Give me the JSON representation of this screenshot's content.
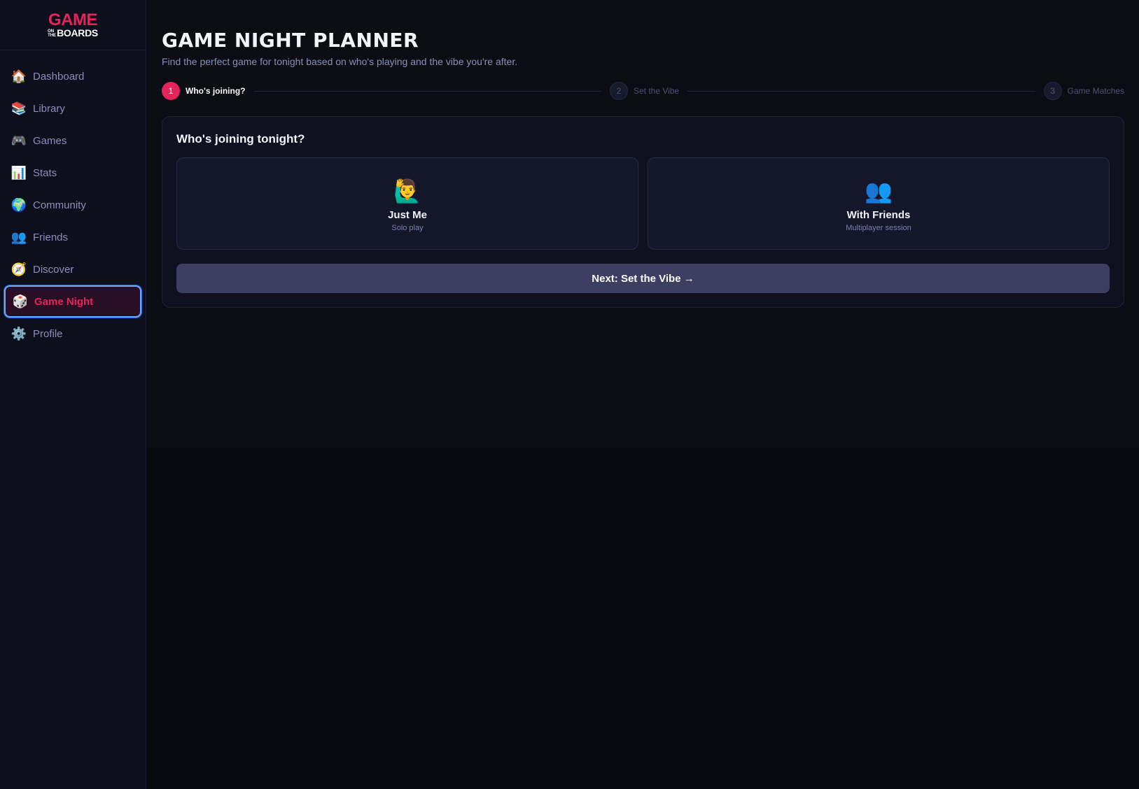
{
  "brand": {
    "logo_top": "GAME",
    "logo_small": "ON",
    "logo_small2": "THE",
    "logo_bottom": "BOARDS",
    "accent_color": "#e5245a"
  },
  "sidebar": {
    "items": [
      {
        "label": "Dashboard",
        "icon": "🏠",
        "icon_name": "house-icon"
      },
      {
        "label": "Library",
        "icon": "📚",
        "icon_name": "books-icon"
      },
      {
        "label": "Games",
        "icon": "🎮",
        "icon_name": "gamepad-icon"
      },
      {
        "label": "Stats",
        "icon": "📊",
        "icon_name": "bar-chart-icon"
      },
      {
        "label": "Community",
        "icon": "🌍",
        "icon_name": "globe-icon"
      },
      {
        "label": "Friends",
        "icon": "👥",
        "icon_name": "people-icon"
      },
      {
        "label": "Discover",
        "icon": "🧭",
        "icon_name": "compass-icon"
      },
      {
        "label": "Game Night",
        "icon": "🎲",
        "icon_name": "dice-icon",
        "active": true
      },
      {
        "label": "Profile",
        "icon": "⚙️",
        "icon_name": "gear-icon"
      }
    ]
  },
  "page": {
    "title": "GAME NIGHT PLANNER",
    "subtitle": "Find the perfect game for tonight based on who's playing and the vibe you're after."
  },
  "stepper": {
    "steps": [
      {
        "number": "1",
        "label": "Who's joining?",
        "state": "active"
      },
      {
        "number": "2",
        "label": "Set the Vibe",
        "state": "inactive"
      },
      {
        "number": "3",
        "label": "Game Matches",
        "state": "inactive"
      }
    ]
  },
  "card": {
    "title": "Who's joining tonight?",
    "options": [
      {
        "icon": "🙋‍♂️",
        "icon_name": "person-raising-hand-icon",
        "title": "Just Me",
        "subtitle": "Solo play"
      },
      {
        "icon": "👥",
        "icon_name": "people-icon",
        "title": "With Friends",
        "subtitle": "Multiplayer session"
      }
    ],
    "next_button": "Next: Set the Vibe →"
  }
}
